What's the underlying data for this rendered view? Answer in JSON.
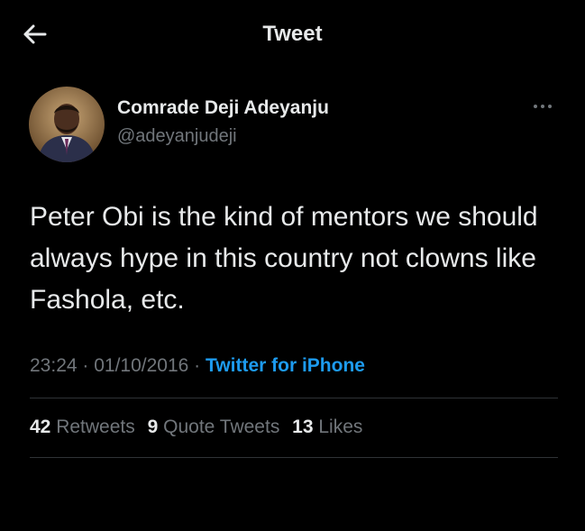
{
  "header": {
    "back_icon": "arrow-left-icon",
    "title": "Tweet"
  },
  "tweet": {
    "avatar_icon": "avatar",
    "author_name": "Comrade Deji Adeyanju",
    "author_handle": "@adeyanjudeji",
    "more_icon": "more-horizontal-icon",
    "text": "Peter Obi is the kind of mentors we should always hype in this country not clowns like Fashola, etc.",
    "time": "23:24",
    "separator": " · ",
    "date": "01/10/2016",
    "source": "Twitter for iPhone"
  },
  "stats": {
    "retweets_count": "42",
    "retweets_label": "Retweets",
    "quotes_count": "9",
    "quotes_label": "Quote Tweets",
    "likes_count": "13",
    "likes_label": "Likes"
  },
  "colors": {
    "background": "#000000",
    "primary_text": "#e7e9ea",
    "secondary_text": "#71767b",
    "link": "#1d9bf0",
    "divider": "#2f3336"
  }
}
